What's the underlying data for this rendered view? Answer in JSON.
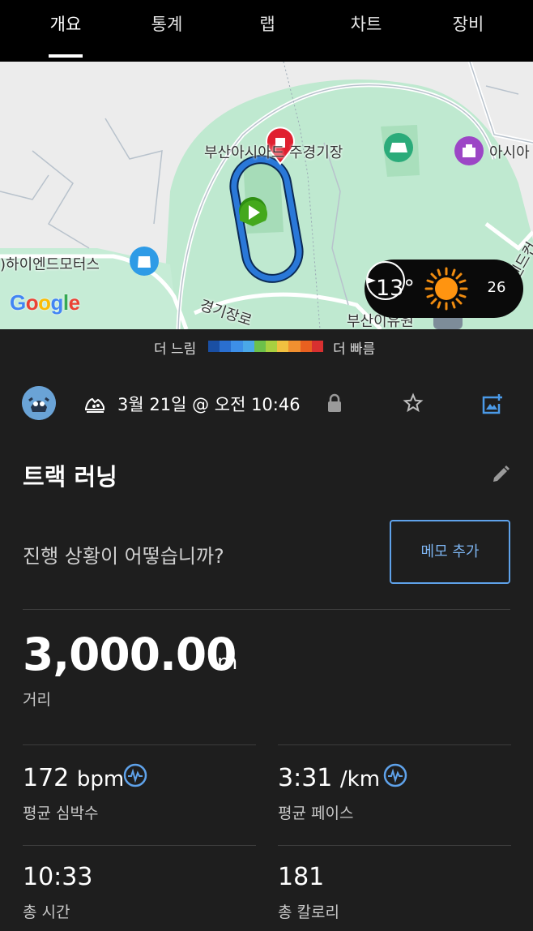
{
  "tabs": [
    {
      "label": "개요",
      "active": true
    },
    {
      "label": "통계",
      "active": false
    },
    {
      "label": "랩",
      "active": false
    },
    {
      "label": "차트",
      "active": false
    },
    {
      "label": "장비",
      "active": false
    }
  ],
  "map": {
    "labels": {
      "stadium": "부산아시아드 주경기장",
      "asia": "아시아",
      "hyundai": ")하이엔드모터스",
      "road": "경기장로",
      "park": "부산이유원",
      "right_edge": "엔드컨"
    },
    "google_logo": "Google",
    "weather": {
      "temperature": "13°",
      "wind_speed": "26",
      "condition_icon": "sun-icon",
      "wind_icon": "wind-direction-icon"
    }
  },
  "pace_legend": {
    "slow_label": "더 느림",
    "fast_label": "더 빠름",
    "colors": [
      "#1a4fa3",
      "#2a6fd0",
      "#3d8fe8",
      "#4aa8e8",
      "#6cc04a",
      "#a8d040",
      "#f0c040",
      "#f09030",
      "#e86020",
      "#d83030"
    ]
  },
  "activity": {
    "type_icon": "running-shoe-icon",
    "date": "3월 21일 @ 오전 10:46",
    "title": "트랙 러닝",
    "question": "진행 상황이 어떻습니까?",
    "memo_button": "메모 추가"
  },
  "distance": {
    "value": "3,000.00",
    "unit": "m",
    "label": "거리"
  },
  "stats": {
    "avg_hr": {
      "value": "172",
      "unit": "bpm",
      "label": "평균 심박수"
    },
    "avg_pace": {
      "value": "3:31",
      "unit": "/km",
      "label": "평균 페이스"
    },
    "total_time": {
      "value": "10:33",
      "label": "총 시간"
    },
    "calories": {
      "value": "181",
      "label": "총 칼로리"
    }
  },
  "colors": {
    "accent_blue": "#5fa2ea",
    "track_blue": "#1e6fd0",
    "start_green": "#3a9a1a",
    "end_red": "#e02030",
    "background": "#1e1e1e"
  }
}
